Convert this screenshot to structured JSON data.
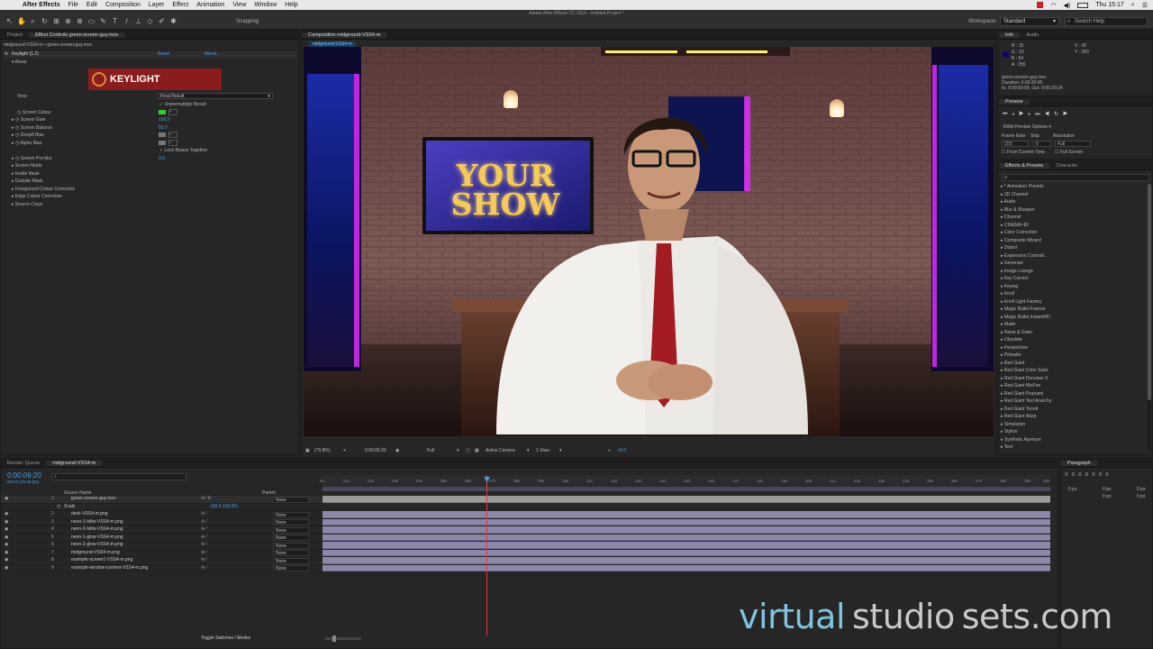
{
  "menubar": {
    "app": "After Effects",
    "items": [
      "File",
      "Edit",
      "Composition",
      "Layer",
      "Effect",
      "Animation",
      "View",
      "Window",
      "Help"
    ],
    "clock": "Thu 15:17"
  },
  "toolbar": {
    "window_title": "Adobe After Effects CC 2014 - Untitled Project *",
    "snapping": "Snapping",
    "workspace_label": "Workspace:",
    "workspace_value": "Standard",
    "search_placeholder": "Search Help"
  },
  "effect_controls": {
    "tabs": [
      "Project",
      "Effect Controls green-screen-guy.mov"
    ],
    "breadcrumb": "midground-VSS4-m • green-screen-guy.mov",
    "effect": "Keylight (1.2)",
    "reset": "Reset",
    "about_link": "About...",
    "about": "About",
    "logo": "KEYLIGHT",
    "view_label": "View",
    "view_value": "Final Result",
    "unpremultiply": "Unpremultiply Result",
    "props": [
      {
        "name": "Screen Colour",
        "value": ""
      },
      {
        "name": "Screen Gain",
        "value": "100.0"
      },
      {
        "name": "Screen Balance",
        "value": "50.0"
      },
      {
        "name": "Despill Bias",
        "value": ""
      },
      {
        "name": "Alpha Bias",
        "value": ""
      }
    ],
    "lock_biases": "Lock Biases Together",
    "pre_blur": {
      "name": "Screen Pre-blur",
      "value": "0.0"
    },
    "groups": [
      "Screen Matte",
      "Inside Mask",
      "Outside Mask",
      "Foreground Colour Correction",
      "Edge Colour Correction",
      "Source Crops"
    ]
  },
  "composition": {
    "tab": "Composition midground-VSS4-m",
    "subtab": "midground-VSS4-m",
    "show_title_1": "YOUR",
    "show_title_2": "SHOW",
    "footer": {
      "zoom": "(79.8%)",
      "time": "0:00:06:20",
      "resolution": "Full",
      "camera": "Active Camera",
      "view": "1 View",
      "exposure": "+0.0"
    }
  },
  "info": {
    "tabs": [
      "Info",
      "Audio"
    ],
    "r": "R : 15",
    "g": "G : 10",
    "b": "B : 94",
    "a": "A : 255",
    "x": "X : 42",
    "y": "Y : 350",
    "file": "green-screen-guy.mov",
    "duration": "Duration: 0:00:30:00",
    "inout": "In: 0:00:00:00, Out: 0:00:29:24"
  },
  "preview": {
    "tab": "Preview",
    "options": "RAM Preview Options",
    "frame_rate_label": "Frame Rate",
    "skip_label": "Skip",
    "resolution_label": "Resolution",
    "frame_rate": "(25)",
    "skip": "0",
    "resolution": "Full",
    "from_current": "From Current Time",
    "full_screen": "Full Screen"
  },
  "effects_presets": {
    "tabs": [
      "Effects & Presets",
      "Character"
    ],
    "search_placeholder": "ρ-",
    "items": [
      "* Animation Presets",
      "3D Channel",
      "Audio",
      "Blur & Sharpen",
      "Channel",
      "CINEMA 4D",
      "Color Correction",
      "Composite Wizard",
      "Distort",
      "Expression Controls",
      "Generate",
      "Image Lounge",
      "Key Correct",
      "Keying",
      "Knoll",
      "Knoll Light Factory",
      "Magic Bullet Frames",
      "Magic Bullet InstantHD",
      "Matte",
      "Noise & Grain",
      "Obsolete",
      "Perspective",
      "Primatte",
      "Red Giant",
      "Red Giant Color Suite",
      "Red Giant Denoiser II",
      "Red Giant MisFire",
      "Red Giant Psunami",
      "Red Giant Text Anarchy",
      "Red Giant ToonIt",
      "Red Giant Warp",
      "Simulation",
      "Stylize",
      "Synthetic Aperture",
      "Text"
    ]
  },
  "timeline": {
    "tabs": [
      "Render Queue",
      "midground-VSS4-m"
    ],
    "timecode": "0:00:06:20",
    "frame_info": "00170 (25.00 fps)",
    "col_source": "Source Name",
    "col_parent": "Parent",
    "scale_label": "Scale",
    "scale_value": "100.0,100.0%",
    "toggle": "Toggle Switches / Modes",
    "layers": [
      {
        "num": "1",
        "name": "green-screen-guy.mov",
        "parent": "None"
      },
      {
        "num": "2",
        "name": "desk-VSS4-m.png",
        "parent": "None"
      },
      {
        "num": "3",
        "name": "neon-1-hilite-VSS4-m.png",
        "parent": "None"
      },
      {
        "num": "4",
        "name": "neon-2-hilite-VSS4-m.png",
        "parent": "None"
      },
      {
        "num": "5",
        "name": "neon-1-glow-VSS4-m.png",
        "parent": "None"
      },
      {
        "num": "6",
        "name": "neon-2-glow-VSS4-m.png",
        "parent": "None"
      },
      {
        "num": "7",
        "name": "midground-VSS4-m.png",
        "parent": "None"
      },
      {
        "num": "8",
        "name": "example-screen1-VSS4-m.png",
        "parent": "None"
      },
      {
        "num": "9",
        "name": "example-window-content-VSS4-m.png",
        "parent": "None"
      }
    ],
    "ticks": [
      "0s",
      "01s",
      "02s",
      "03s",
      "04s",
      "05s",
      "06s",
      "07s",
      "08s",
      "09s",
      "10s",
      "11s",
      "12s",
      "13s",
      "14s",
      "15s",
      "16s",
      "17s",
      "18s",
      "19s",
      "20s",
      "21s",
      "22s",
      "23s",
      "24s",
      "25s",
      "26s",
      "27s",
      "28s",
      "29s",
      "30s"
    ]
  },
  "paragraph": {
    "tab": "Paragraph",
    "indent": "0 px"
  },
  "watermark": {
    "part1": "virtual",
    "part2": "studio",
    "part3": "sets",
    "part4": ".com"
  },
  "colors": {
    "accent_blue": "#4a9de0",
    "layer_bar": "#8d86a6",
    "playhead": "#e23a3a",
    "keylight_red": "#8a1c1c",
    "screen_colour": "#2bd42b"
  }
}
